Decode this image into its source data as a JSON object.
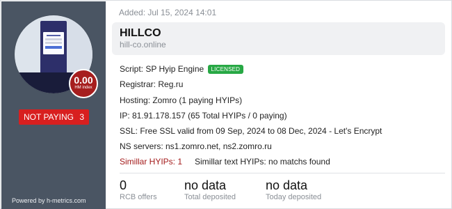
{
  "sidebar": {
    "hm_index_value": "0.00",
    "hm_index_label": "HM index",
    "status_label": "NOT PAYING",
    "status_count": "3",
    "powered_by": "Powered by h-metrics.com",
    "status_color": "#d81f1f"
  },
  "header": {
    "added": "Added: Jul 15, 2024 14:01",
    "name": "HILLCO",
    "url": "hill-co.online"
  },
  "details": {
    "script_label": "Script: SP Hyip Engine",
    "license_badge": "LICENSED",
    "license_color": "#27a844",
    "registrar": "Registrar: Reg.ru",
    "hosting": "Hosting: Zomro (1 paying HYIPs)",
    "ip": "IP: 81.91.178.157 (65 Total HYIPs / 0 paying)",
    "ssl": "SSL: Free SSL valid from 09 Sep, 2024 to 08 Dec, 2024 - Let's Encrypt",
    "ns": "NS servers: ns1.zomro.net, ns2.zomro.ru",
    "similar_hyips": "Simillar HYIPs: 1",
    "similar_text": "Simillar text HYIPs: no matchs found"
  },
  "stats": {
    "rcb_value": "0",
    "rcb_label": "RCB offers",
    "deposited_value": "no data",
    "deposited_label": "Total deposited",
    "today_value": "no data",
    "today_label": "Today deposited"
  }
}
